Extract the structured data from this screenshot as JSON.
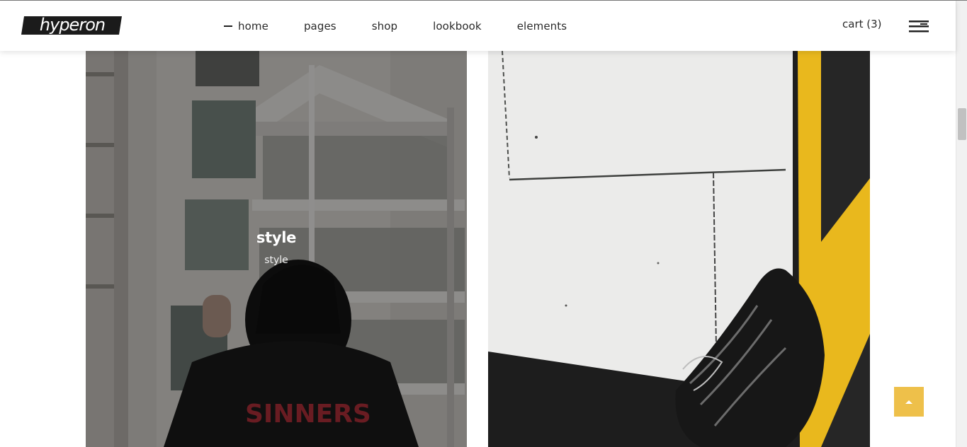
{
  "header": {
    "logo_text": "hyperon",
    "nav": [
      {
        "label": "home",
        "active": true
      },
      {
        "label": "pages",
        "active": false
      },
      {
        "label": "shop",
        "active": false
      },
      {
        "label": "lookbook",
        "active": false
      },
      {
        "label": "elements",
        "active": false
      }
    ],
    "cart_label": "cart (3)",
    "menu_icon": "hamburger-menu-icon"
  },
  "gallery": {
    "cards": [
      {
        "title": "style",
        "subtitle": "style",
        "hovered": true
      },
      {
        "title": "",
        "subtitle": "",
        "hovered": false
      }
    ]
  },
  "back_to_top_icon": "arrow-up-icon",
  "colors": {
    "accent": "#eec04a",
    "logo_bg": "#1b1b1b",
    "text": "#2a2a2a",
    "stripe_yellow": "#e9b81d"
  }
}
